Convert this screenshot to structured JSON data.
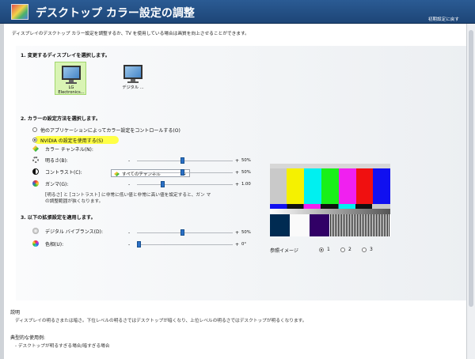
{
  "header": {
    "title": "デスクトップ カラー設定の調整",
    "restore_label": "初期設定に戻す"
  },
  "intro": "ディスプレイのデスクトップ カラー設定を調整するか、TV を使用している場合は画質を向上させることができます。",
  "section1": {
    "heading": "1. 変更するディスプレイを選択します。",
    "displays": [
      {
        "label": "LG Electronics..."
      },
      {
        "label": "デジタル ..."
      }
    ]
  },
  "section2": {
    "heading": "2. カラーの設定方法を選択します。",
    "radio_other": "他のアプリケーションによってカラー設定をコントロールする(O)",
    "radio_nvidia": "NVIDIA の設定を使用する(S)",
    "channel_label": "カラー チャンネル(N):",
    "channel_value": "すべてのチャンネル",
    "brightness_label": "明るさ(B):",
    "brightness_value": "50%",
    "contrast_label": "コントラスト(C):",
    "contrast_value": "50%",
    "gamma_label": "ガンマ(G):",
    "gamma_value": "1.00",
    "note": "[明るさ] と [コントラスト] に非常に低い値と非常に高い値を設定すると、ガン マの調整範囲が狭くなります。"
  },
  "section3": {
    "heading": "3. 以下の拡張設定を適用します。",
    "vibrance_label": "デジタル バイブランス(D):",
    "vibrance_value": "50%",
    "hue_label": "色相(U):",
    "hue_value": "0°"
  },
  "slider_ranges": {
    "minus": "-",
    "plus": "+"
  },
  "reference": {
    "label": "参照イメージ",
    "option1": "1",
    "option2": "2",
    "option3": "3"
  },
  "description": {
    "title": "説明",
    "text": "ディスプレイの明るさまたは暗さ。下位レベルの明るさではデスクトップが暗くなり、上位レベルの明るさではデスクトップが明るくなります。",
    "usage_title": "典型的な使用例:",
    "usage_item": "- デスクトップが明るすぎる場合/暗すぎる場合"
  },
  "slider_levels": {
    "brightness": 0.5,
    "contrast": 0.5,
    "gamma": 0.33,
    "vibrance": 0.5,
    "hue": 0
  },
  "colors": {
    "header_blue": "#1d4577",
    "selected_green": "#d9f4b4",
    "slider_blue": "#2b70c6",
    "highlight_yellow": "#ffff46"
  }
}
